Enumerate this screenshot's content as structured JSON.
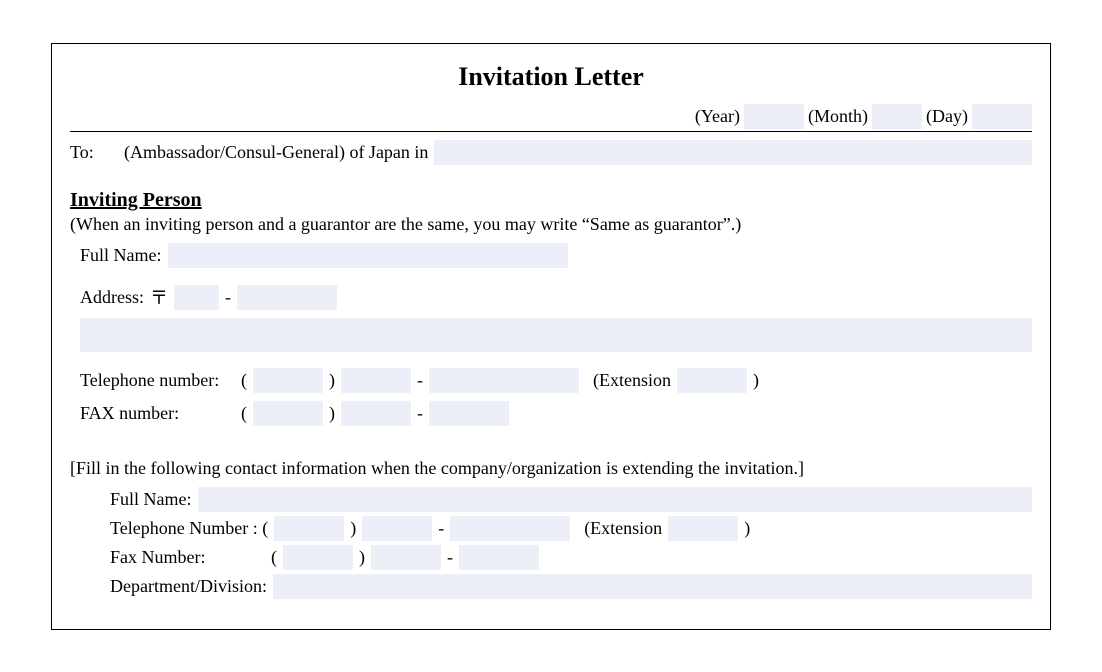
{
  "title": "Invitation Letter",
  "date": {
    "year_label": "(Year)",
    "month_label": "(Month)",
    "day_label": "(Day)"
  },
  "to_label": "To:",
  "to_text": "(Ambassador/Consul-General) of Japan in",
  "section": {
    "heading": "Inviting Person",
    "note": "(When an inviting person and a guarantor are the same, you may write “Same as guarantor”.)",
    "full_name_label": "Full Name:",
    "address_label": "Address:",
    "postal_mark": "〒",
    "dash": "-",
    "tel_label": "Telephone number:",
    "fax_label": "FAX number:",
    "paren_open": "(",
    "paren_close": ")",
    "extension_label": "(Extension",
    "ext_close": ")"
  },
  "org": {
    "instruction": "[Fill in the following contact information when the company/organization is extending the invitation.]",
    "full_name_label": "Full Name:",
    "tel_label": "Telephone Number : (",
    "paren_close": ")",
    "dash": "-",
    "extension_label": "(Extension",
    "ext_close": ")",
    "fax_label": "Fax Number:",
    "fax_paren_open": "(",
    "dept_label": "Department/Division:"
  }
}
